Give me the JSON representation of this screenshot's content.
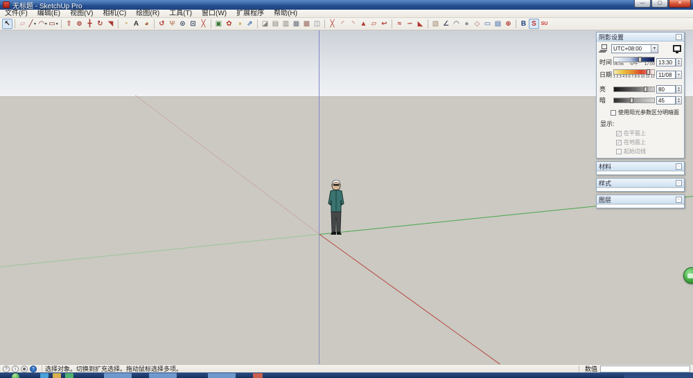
{
  "window": {
    "title": "无标题 - SketchUp Pro",
    "controls": {
      "minimize": "—",
      "maximize": "▢",
      "close": "✕"
    }
  },
  "menu": {
    "items": [
      "文件(F)",
      "编辑(E)",
      "视图(V)",
      "相机(C)",
      "绘图(R)",
      "工具(T)",
      "窗口(W)",
      "扩展程序",
      "帮助(H)"
    ]
  },
  "toolbar": {
    "groups": [
      {
        "icons": [
          {
            "name": "select-tool",
            "glyph": "↖",
            "color": "#1a1a1a",
            "pressed": true
          }
        ]
      },
      {
        "icons": [
          {
            "name": "eraser-tool",
            "glyph": "▱",
            "color": "#d0899f"
          },
          {
            "name": "line-tool",
            "glyph": "╱",
            "color": "#7a1f1f",
            "dropdown": true
          },
          {
            "name": "arc-tool",
            "glyph": "◠",
            "color": "#7a1f1f",
            "dropdown": true
          },
          {
            "name": "rectangle-tool",
            "glyph": "▭",
            "color": "#7a1f1f",
            "dropdown": true
          }
        ]
      },
      {
        "icons": [
          {
            "name": "push-pull-tool",
            "glyph": "⇧",
            "color": "#a63a32"
          },
          {
            "name": "offset-tool",
            "glyph": "⊚",
            "color": "#a63a32"
          },
          {
            "name": "move-tool",
            "glyph": "╋",
            "color": "#a63a32"
          },
          {
            "name": "rotate-tool",
            "glyph": "↻",
            "color": "#a63a32"
          },
          {
            "name": "scale-tool",
            "glyph": "◥",
            "color": "#a63a32"
          }
        ]
      },
      {
        "icons": [
          {
            "name": "tape-measure-tool",
            "glyph": "◔",
            "color": "#c49a2e"
          },
          {
            "name": "dimension-tool",
            "glyph": "A",
            "color": "#333333"
          },
          {
            "name": "paint-bucket-tool",
            "glyph": "◕",
            "color": "#a05a28"
          }
        ]
      },
      {
        "icons": [
          {
            "name": "orbit-tool",
            "glyph": "↺",
            "color": "#b03a32"
          },
          {
            "name": "pan-tool",
            "glyph": "Ψ",
            "color": "#c09070"
          },
          {
            "name": "zoom-tool",
            "glyph": "⊙",
            "color": "#2e3e5e"
          },
          {
            "name": "zoom-window-tool",
            "glyph": "⊡",
            "color": "#2e3e5e"
          },
          {
            "name": "zoom-extents-tool",
            "glyph": "╳",
            "color": "#b03a32"
          }
        ]
      },
      {
        "icons": [
          {
            "name": "get-models",
            "glyph": "▣",
            "color": "#3a7a3a"
          },
          {
            "name": "components-window",
            "glyph": "✿",
            "color": "#b03a32"
          },
          {
            "name": "styles-window",
            "glyph": "◑",
            "color": "#c49a2e"
          },
          {
            "name": "share-model",
            "glyph": "⇗",
            "color": "#3a62a8"
          }
        ]
      },
      {
        "icons": [
          {
            "name": "section-plane-tool",
            "glyph": "◪",
            "color": "#88827a"
          },
          {
            "name": "display-section-planes",
            "glyph": "▤",
            "color": "#88827a"
          },
          {
            "name": "display-section-cuts",
            "glyph": "▥",
            "color": "#88827a"
          },
          {
            "name": "grid-tool",
            "glyph": "▦",
            "color": "#6a7080"
          },
          {
            "name": "grid-detail-tool",
            "glyph": "▩",
            "color": "#9a6a62"
          },
          {
            "name": "stacked-planes-tool",
            "glyph": "◫",
            "color": "#7a8290"
          }
        ]
      },
      {
        "icons": [
          {
            "name": "axes-tool",
            "glyph": "╳",
            "color": "#b03a32"
          },
          {
            "name": "two-point-arc-tool",
            "glyph": "◜",
            "color": "#b03a32"
          },
          {
            "name": "three-point-arc-tool",
            "glyph": "◝",
            "color": "#b03a32"
          },
          {
            "name": "polygon-tool",
            "glyph": "▲",
            "color": "#b03a32"
          },
          {
            "name": "shape-tool",
            "glyph": "▱",
            "color": "#b03a32"
          },
          {
            "name": "curve-tool",
            "glyph": "↩",
            "color": "#b03a32"
          }
        ]
      },
      {
        "icons": [
          {
            "name": "freehand-tool",
            "glyph": "≈",
            "color": "#b03a32"
          },
          {
            "name": "bezier-tool",
            "glyph": "∽",
            "color": "#b03a32"
          },
          {
            "name": "fold-tool",
            "glyph": "◣",
            "color": "#b03a32"
          }
        ]
      },
      {
        "icons": [
          {
            "name": "sandbox-tool",
            "glyph": "▧",
            "color": "#a08a70"
          },
          {
            "name": "protractor-tool",
            "glyph": "∠",
            "color": "#44485a"
          },
          {
            "name": "dome-tool",
            "glyph": "◠",
            "color": "#44485a"
          },
          {
            "name": "sphere-tool",
            "glyph": "●",
            "color": "#888e96"
          },
          {
            "name": "pages-tool",
            "glyph": "◇",
            "color": "#a06a5a"
          },
          {
            "name": "plan-view-tool",
            "glyph": "▭",
            "color": "#3a62a8"
          },
          {
            "name": "windows-tool",
            "glyph": "▤",
            "color": "#3a62a8"
          },
          {
            "name": "compass-tool",
            "glyph": "⊕",
            "color": "#b03a32"
          }
        ]
      },
      {
        "icons": [
          {
            "name": "3d-warehouse",
            "glyph": "B",
            "color": "#1f3f7f"
          },
          {
            "name": "extension-warehouse",
            "glyph": "S",
            "color": "#c23330",
            "pressed": true
          },
          {
            "name": "sketchup-logo",
            "glyph": "SU",
            "color": "#c23330"
          }
        ]
      }
    ]
  },
  "shadow_panel": {
    "title": "阴影设置",
    "timezone": "UTC+08:00",
    "time": {
      "label": "时间",
      "start": "06:55",
      "noon": "中午",
      "end": "17:00",
      "value": "13:30",
      "pos": 65
    },
    "date": {
      "label": "日期",
      "ticks": [
        "1",
        "2",
        "3",
        "4",
        "5",
        "6",
        "7",
        "8",
        "9",
        "10",
        "11",
        "12"
      ],
      "value": "11/08",
      "pos": 86
    },
    "light": {
      "label": "亮",
      "value": "80",
      "pos": 80
    },
    "dark": {
      "label": "暗",
      "value": "45",
      "pos": 45
    },
    "use_sun_label": "使用阳光参数区分明暗面",
    "display_label": "显示:",
    "display_options": [
      {
        "label": "在平面上",
        "checked": true
      },
      {
        "label": "在地面上",
        "checked": true
      },
      {
        "label": "起始边线",
        "checked": false
      }
    ]
  },
  "side_panels": [
    {
      "name": "materials",
      "title": "材料"
    },
    {
      "name": "styles",
      "title": "样式"
    },
    {
      "name": "layers",
      "title": "图层"
    }
  ],
  "statusbar": {
    "icons": [
      {
        "name": "status-geolocation-icon",
        "glyph": "?"
      },
      {
        "name": "status-credits-icon",
        "glyph": "i"
      },
      {
        "name": "status-signin-icon",
        "glyph": "☻"
      },
      {
        "name": "status-help-icon",
        "glyph": "?",
        "accent": true
      }
    ],
    "message": "选择对象。切换到扩充选择。拖动鼠标选择多项。",
    "measure_label": "数值",
    "measure_value": ""
  },
  "viewport": {
    "axis": {
      "red": "#b8463e",
      "green": "#4aa54a",
      "blue": "#8084cc"
    }
  }
}
